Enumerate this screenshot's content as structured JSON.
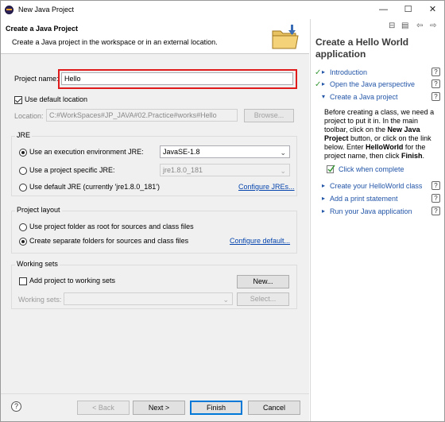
{
  "window": {
    "title": "New Java Project",
    "minimize_glyph": "—",
    "maximize_glyph": "☐",
    "close_glyph": "✕"
  },
  "banner": {
    "title": "Create a Java Project",
    "description": "Create a Java project in the workspace or in an external location."
  },
  "project": {
    "name_label": "Project name:",
    "name_value": "Hello",
    "use_default_label": "Use default location",
    "use_default_checked": true,
    "location_label": "Location:",
    "location_value": "C:#WorkSpaces#JP_JAVA#02.Practice#works#Hello",
    "browse_label": "Browse..."
  },
  "jre": {
    "group_title": "JRE",
    "exec_env_label": "Use an execution environment JRE:",
    "exec_env_value": "JavaSE-1.8",
    "specific_label": "Use a project specific JRE:",
    "specific_value": "jre1.8.0_181",
    "default_label": "Use default JRE (currently 'jre1.8.0_181')",
    "configure_link": "Configure JREs..."
  },
  "layout": {
    "group_title": "Project layout",
    "root_label": "Use project folder as root for sources and class files",
    "separate_label": "Create separate folders for sources and class files",
    "configure_link": "Configure default..."
  },
  "working_sets": {
    "group_title": "Working sets",
    "add_label": "Add project to working sets",
    "new_label": "New...",
    "sets_label": "Working sets:",
    "select_label": "Select..."
  },
  "footer": {
    "back_label": "< Back",
    "next_label": "Next >",
    "finish_label": "Finish",
    "cancel_label": "Cancel",
    "help_glyph": "?"
  },
  "cheatsheet": {
    "title": "Create a Hello World application",
    "steps": [
      {
        "label": "Introduction",
        "done": true
      },
      {
        "label": "Open the Java perspective",
        "done": true
      },
      {
        "label": "Create a Java project",
        "current": true
      }
    ],
    "body": "Before creating a class, we need a project to put it in. In the main toolbar, click on the ",
    "body_bold1": "New Java Project",
    "body2": " button, or click on the link below. Enter ",
    "body_bold2": "HelloWorld",
    "body3": " for the project name, then click ",
    "body_bold3": "Finish",
    "body4": ".",
    "click_when_complete": "Click when complete",
    "next_steps": [
      "Create your HelloWorld class",
      "Add a print statement",
      "Run your Java application"
    ],
    "help_glyph": "?"
  },
  "colors": {
    "highlight_border": "#e01b1b",
    "link": "#0645ad",
    "cheatsheet_link": "#2255a8",
    "done_check": "#3a9a3a"
  }
}
